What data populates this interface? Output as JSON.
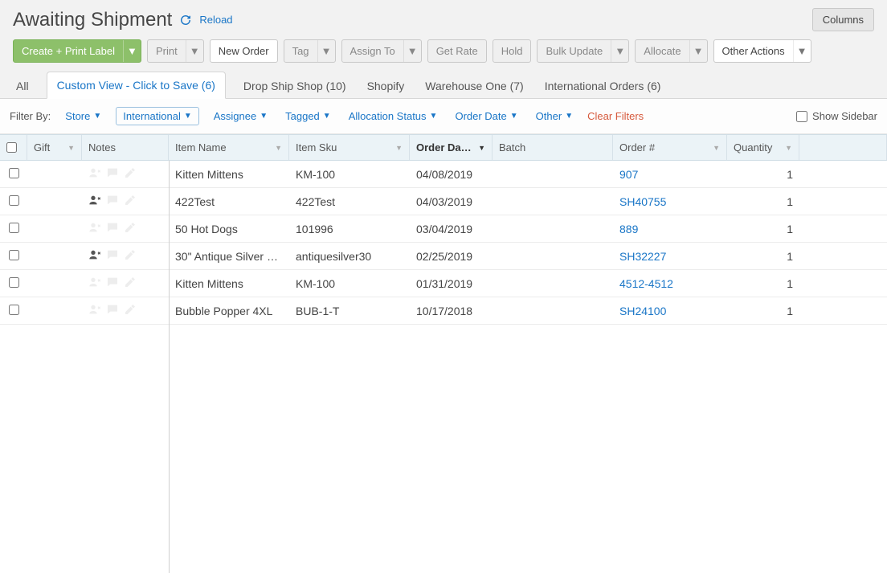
{
  "header": {
    "title": "Awaiting Shipment",
    "reload_label": "Reload",
    "columns_label": "Columns"
  },
  "toolbar": {
    "create_print": "Create + Print Label",
    "print": "Print",
    "new_order": "New Order",
    "tag": "Tag",
    "assign_to": "Assign To",
    "get_rate": "Get Rate",
    "hold": "Hold",
    "bulk_update": "Bulk Update",
    "allocate": "Allocate",
    "other_actions": "Other Actions"
  },
  "tabs": [
    {
      "label": "All",
      "active": false
    },
    {
      "label": "Custom View - Click to Save (6)",
      "active": true
    },
    {
      "label": "Drop Ship Shop (10)",
      "active": false
    },
    {
      "label": "Shopify",
      "active": false
    },
    {
      "label": "Warehouse One (7)",
      "active": false
    },
    {
      "label": "International Orders (6)",
      "active": false
    }
  ],
  "filterbar": {
    "label": "Filter By:",
    "store": "Store",
    "international": "International",
    "assignee": "Assignee",
    "tagged": "Tagged",
    "allocation_status": "Allocation Status",
    "order_date": "Order Date",
    "other": "Other",
    "clear_filters": "Clear Filters",
    "show_sidebar": "Show Sidebar"
  },
  "columns": {
    "gift": "Gift",
    "notes": "Notes",
    "item_name": "Item Name",
    "item_sku": "Item Sku",
    "order_date": "Order Da…",
    "batch": "Batch",
    "order_num": "Order #",
    "quantity": "Quantity"
  },
  "rows": [
    {
      "assigned": false,
      "item_name": "Kitten Mittens",
      "item_sku": "KM-100",
      "order_date": "04/08/2019",
      "batch": "",
      "order_num": "907",
      "quantity": "1"
    },
    {
      "assigned": true,
      "item_name": "422Test",
      "item_sku": "422Test",
      "order_date": "04/03/2019",
      "batch": "",
      "order_num": "SH40755",
      "quantity": "1"
    },
    {
      "assigned": false,
      "item_name": "50 Hot Dogs",
      "item_sku": "101996",
      "order_date": "03/04/2019",
      "batch": "",
      "order_num": "889",
      "quantity": "1"
    },
    {
      "assigned": true,
      "item_name": "30\" Antique Silver o…",
      "item_sku": "antiquesilver30",
      "order_date": "02/25/2019",
      "batch": "",
      "order_num": "SH32227",
      "quantity": "1"
    },
    {
      "assigned": false,
      "item_name": "Kitten Mittens",
      "item_sku": "KM-100",
      "order_date": "01/31/2019",
      "batch": "",
      "order_num": "4512-4512",
      "quantity": "1"
    },
    {
      "assigned": false,
      "item_name": "Bubble Popper 4XL",
      "item_sku": "BUB-1-T",
      "order_date": "10/17/2018",
      "batch": "",
      "order_num": "SH24100",
      "quantity": "1"
    }
  ]
}
